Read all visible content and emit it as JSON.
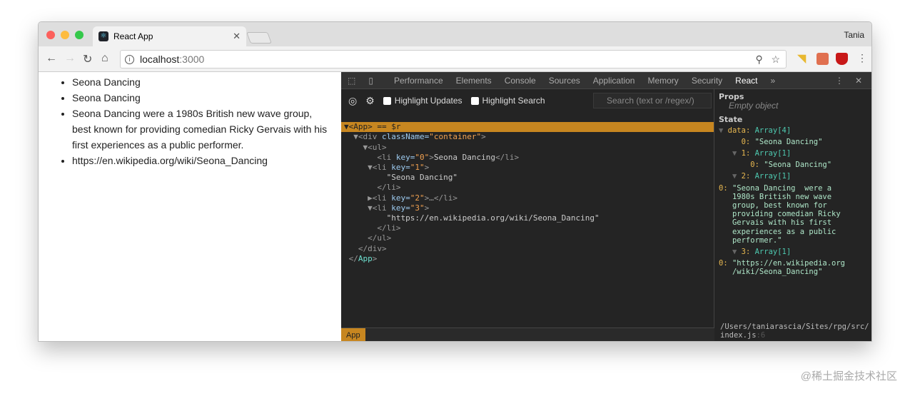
{
  "browser": {
    "tab_title": "React App",
    "user": "Tania",
    "url_host": "localhost",
    "url_port": ":3000"
  },
  "page": {
    "items": [
      "Seona Dancing",
      "Seona Dancing",
      "Seona Dancing were a 1980s British new wave group, best known for providing comedian Ricky Gervais with his first experiences as a public performer.",
      "https://en.wikipedia.org/wiki/Seona_Dancing"
    ]
  },
  "devtools": {
    "tabs": [
      "Performance",
      "Elements",
      "Console",
      "Sources",
      "Application",
      "Memory",
      "Security",
      "React"
    ],
    "more": "»",
    "highlight_updates": "Highlight Updates",
    "highlight_search": "Highlight Search",
    "search_placeholder": "Search (text or /regex/)",
    "tree": {
      "root": "▼<App> == $r",
      "div_open": "▼<div ",
      "classname_attr": "className=",
      "classname_val": "\"container\"",
      "ul_open": "▼<ul>",
      "li0": "Seona Dancing",
      "li1_text": "\"Seona Dancing\"",
      "li3_text": "\"https://en.wikipedia.org/wiki/Seona_Dancing\"",
      "app_close": "App"
    },
    "breadcrumb": "App",
    "props_label": "Props",
    "props_empty": "Empty object",
    "state_label": "State",
    "state": {
      "data_key": "data:",
      "data_type": "Array[4]",
      "i0": "\"Seona Dancing\"",
      "i1_type": "Array[1]",
      "i1_0": "\"Seona Dancing\"",
      "i2_type": "Array[1]",
      "i2_0": "\"Seona Dancing  were a\n1980s British new wave\ngroup, best known for\nproviding comedian Ricky\nGervais with his first\nexperiences as a public\nperformer.\"",
      "i3_type": "Array[1]",
      "i3_0": "\"https://en.wikipedia.org\n/wiki/Seona_Dancing\""
    },
    "source_path": "/Users/taniarascia/Sites/rpg/src/\nindex.js",
    "source_line": ":6"
  },
  "watermark": "@稀土掘金技术社区"
}
